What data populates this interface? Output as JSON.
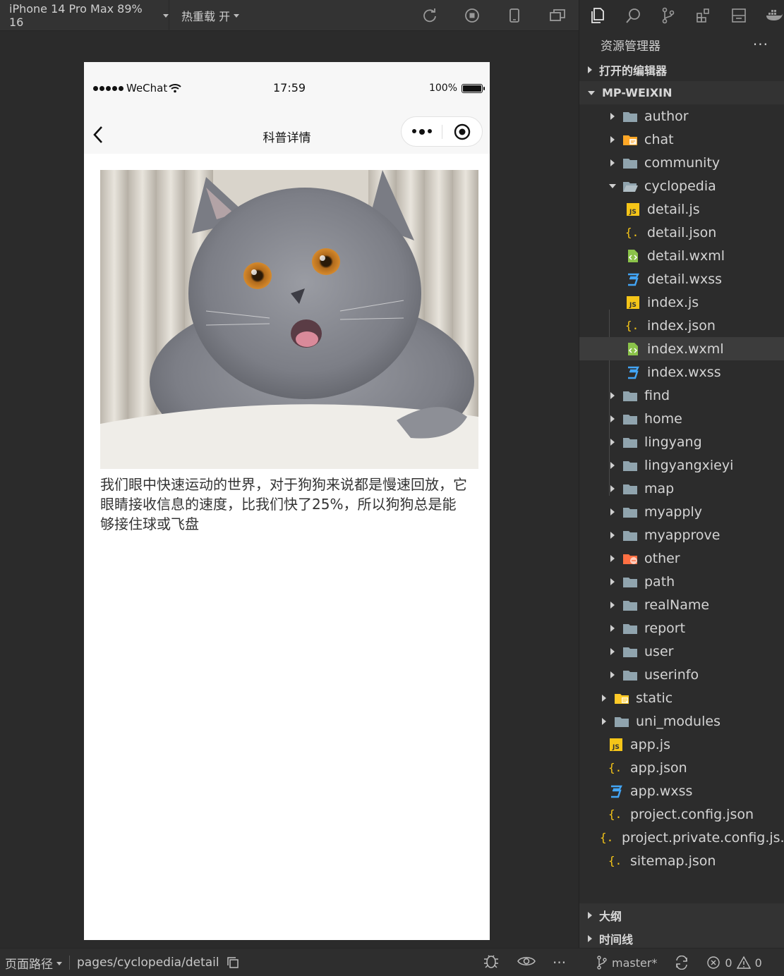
{
  "toolbar": {
    "device_label": "iPhone 14 Pro Max 89% 16",
    "hot_reload_label": "热重载 开"
  },
  "phone": {
    "carrier": "WeChat",
    "time": "17:59",
    "battery": "100%",
    "nav_title": "科普详情",
    "article_text": "我们眼中快速运动的世界，对于狗狗来说都是慢速回放，它眼睛接收信息的速度，比我们快了25%，所以狗狗总是能够接住球或飞盘"
  },
  "explorer": {
    "header": "资源管理器",
    "more": "···",
    "open_editors": "打开的编辑器",
    "project": "MP-WEIXIN",
    "outline": "大纲",
    "timeline": "时间线",
    "tree": [
      {
        "label": "author",
        "type": "folder",
        "level": 1
      },
      {
        "label": "chat",
        "type": "folder-chat",
        "level": 1
      },
      {
        "label": "community",
        "type": "folder",
        "level": 1
      },
      {
        "label": "cyclopedia",
        "type": "folder-open",
        "level": 1
      },
      {
        "label": "detail.js",
        "type": "js",
        "level": 2
      },
      {
        "label": "detail.json",
        "type": "json",
        "level": 2
      },
      {
        "label": "detail.wxml",
        "type": "wxml",
        "level": 2
      },
      {
        "label": "detail.wxss",
        "type": "wxss",
        "level": 2
      },
      {
        "label": "index.js",
        "type": "js",
        "level": 2
      },
      {
        "label": "index.json",
        "type": "json",
        "level": 2
      },
      {
        "label": "index.wxml",
        "type": "wxml",
        "level": 2,
        "selected": true
      },
      {
        "label": "index.wxss",
        "type": "wxss",
        "level": 2
      },
      {
        "label": "find",
        "type": "folder",
        "level": 1
      },
      {
        "label": "home",
        "type": "folder",
        "level": 1
      },
      {
        "label": "lingyang",
        "type": "folder",
        "level": 1
      },
      {
        "label": "lingyangxieyi",
        "type": "folder",
        "level": 1
      },
      {
        "label": "map",
        "type": "folder",
        "level": 1
      },
      {
        "label": "myapply",
        "type": "folder",
        "level": 1
      },
      {
        "label": "myapprove",
        "type": "folder",
        "level": 1
      },
      {
        "label": "other",
        "type": "folder-other",
        "level": 1
      },
      {
        "label": "path",
        "type": "folder",
        "level": 1
      },
      {
        "label": "realName",
        "type": "folder",
        "level": 1
      },
      {
        "label": "report",
        "type": "folder",
        "level": 1
      },
      {
        "label": "user",
        "type": "folder",
        "level": 1
      },
      {
        "label": "userinfo",
        "type": "folder",
        "level": 1
      },
      {
        "label": "static",
        "type": "folder-static",
        "level": 0
      },
      {
        "label": "uni_modules",
        "type": "folder",
        "level": 0
      },
      {
        "label": "app.js",
        "type": "js",
        "level": 0
      },
      {
        "label": "app.json",
        "type": "json",
        "level": 0
      },
      {
        "label": "app.wxss",
        "type": "wxss",
        "level": 0
      },
      {
        "label": "project.config.json",
        "type": "json",
        "level": 0
      },
      {
        "label": "project.private.config.js...",
        "type": "json",
        "level": 0
      },
      {
        "label": "sitemap.json",
        "type": "json",
        "level": 0
      }
    ]
  },
  "statusbar": {
    "page_path_label": "页面路径",
    "page_path": "pages/cyclopedia/detail",
    "branch": "master*",
    "errors": "0",
    "warnings": "0"
  }
}
